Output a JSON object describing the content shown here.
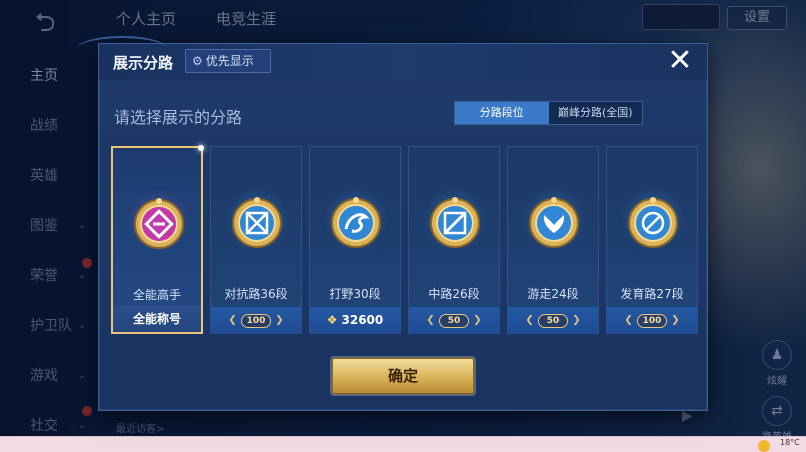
{
  "nav": {
    "back_icon": "back-arrow-icon",
    "items": [
      {
        "label": "主页",
        "active": true
      },
      {
        "label": "战绩"
      },
      {
        "label": "英雄"
      },
      {
        "label": "图鉴",
        "chevron": true
      },
      {
        "label": "荣誉",
        "chevron": true
      },
      {
        "label": "护卫队",
        "chevron": true
      },
      {
        "label": "游戏",
        "chevron": true
      },
      {
        "label": "社交",
        "chevron": true
      }
    ]
  },
  "top_tabs": [
    "个人主页",
    "电竞生涯"
  ],
  "top_right": {
    "settings_label": "设置"
  },
  "side_actions": [
    {
      "label": "炫耀"
    },
    {
      "label": "换英雄"
    }
  ],
  "bottom": {
    "visitors_label": "最近访客>"
  },
  "taskbar": {
    "temperature": "18°C"
  },
  "dialog": {
    "title": "展示分路",
    "pin_label": "优先显示",
    "subtitle": "请选择展示的分路",
    "segments": [
      {
        "label": "分路段位",
        "active": true
      },
      {
        "label": "巅峰分路(全国)",
        "active": false
      }
    ],
    "cards": [
      {
        "label": "全能高手",
        "footer": "全能称号",
        "selected": true,
        "color": "#c23aa8",
        "icon": "omni-badge-icon"
      },
      {
        "label": "对抗路36段",
        "footer_plate": "100",
        "color": "#2f87d6",
        "icon": "clash-lane-badge-icon"
      },
      {
        "label": "打野30段",
        "footer_value": "32600",
        "color": "#2f87d6",
        "icon": "jungle-dragon-badge-icon"
      },
      {
        "label": "中路26段",
        "footer_plate": "50",
        "color": "#2f87d6",
        "icon": "mid-lane-badge-icon"
      },
      {
        "label": "游走24段",
        "footer_plate": "50",
        "color": "#2f87d6",
        "icon": "roam-wings-badge-icon"
      },
      {
        "label": "发育路27段",
        "footer_plate": "100",
        "color": "#2f87d6",
        "icon": "farm-lane-badge-icon"
      }
    ],
    "confirm_label": "确定"
  }
}
